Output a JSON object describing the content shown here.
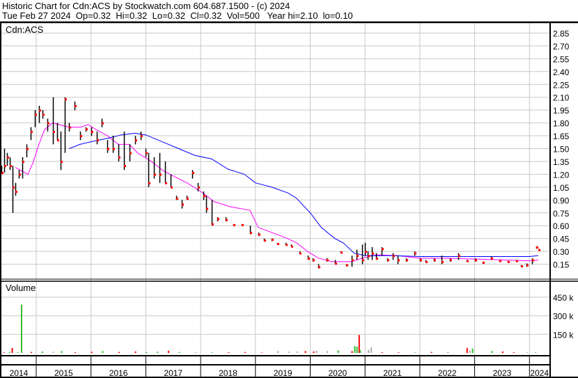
{
  "header": {
    "line1": "Historic Chart for Cdn:ACS by Stockwatch.com 604.687.1500 - (c) 2024",
    "line2": "Tue Feb 27 2024  Op=0.32  Hi=0.32  Lo=0.32  Cl=0.32  Vol=500   Year hi=2.10  lo=0.10"
  },
  "colors": {
    "hilo": "#000000",
    "close": "#ff0000",
    "ma_short": "#ff00ff",
    "ma_long": "#0000ff",
    "vol_up": "#33bb33",
    "vol_down": "#ff0000",
    "vol_flat": "#aaaaaa",
    "grid": "#c8c8c8"
  },
  "chart_data": {
    "type": "line",
    "price_panel": {
      "label": "Cdn:ACS",
      "y_ticks": [
        "2.85",
        "2.70",
        "2.55",
        "2.40",
        "2.25",
        "2.10",
        "1.95",
        "1.80",
        "1.65",
        "1.50",
        "1.35",
        "1.20",
        "1.05",
        "0.90",
        "0.75",
        "0.60",
        "0.45",
        "0.30",
        "0.15"
      ],
      "xlim": [
        2014.36,
        2024.37
      ],
      "ylim": [
        0,
        2.95
      ],
      "bars_t_hi_lo_close": [
        [
          2014.37,
          1.3,
          1.2,
          1.22
        ],
        [
          2014.42,
          1.5,
          1.22,
          1.3
        ],
        [
          2014.47,
          1.45,
          1.3,
          1.4
        ],
        [
          2014.52,
          1.4,
          1.25,
          1.3
        ],
        [
          2014.57,
          1.3,
          0.75,
          1.05
        ],
        [
          2014.62,
          1.1,
          0.95,
          1.0
        ],
        [
          2014.68,
          1.25,
          1.15,
          1.2
        ],
        [
          2014.75,
          1.4,
          1.15,
          1.35
        ],
        [
          2014.82,
          1.55,
          1.4,
          1.5
        ],
        [
          2014.9,
          1.75,
          1.6,
          1.7
        ],
        [
          2014.97,
          1.95,
          1.75,
          1.9
        ],
        [
          2015.05,
          2.0,
          1.8,
          1.95
        ],
        [
          2015.12,
          1.95,
          1.85,
          1.9
        ],
        [
          2015.2,
          1.85,
          1.7,
          1.8
        ],
        [
          2015.3,
          2.1,
          1.55,
          1.7
        ],
        [
          2015.38,
          1.8,
          1.6,
          1.6
        ],
        [
          2015.45,
          1.7,
          1.25,
          1.35
        ],
        [
          2015.52,
          2.1,
          1.45,
          2.08
        ],
        [
          2015.6,
          1.8,
          1.7,
          1.75
        ],
        [
          2015.7,
          2.05,
          1.95,
          2.0
        ],
        [
          2015.8,
          1.7,
          1.6,
          1.65
        ],
        [
          2015.9,
          1.75,
          1.7,
          1.73
        ],
        [
          2016.0,
          1.75,
          1.65,
          1.7
        ],
        [
          2016.1,
          1.7,
          1.55,
          1.6
        ],
        [
          2016.2,
          1.85,
          1.75,
          1.8
        ],
        [
          2016.3,
          1.6,
          1.45,
          1.5
        ],
        [
          2016.4,
          1.65,
          1.45,
          1.5
        ],
        [
          2016.5,
          1.55,
          1.35,
          1.4
        ],
        [
          2016.6,
          1.7,
          1.25,
          1.3
        ],
        [
          2016.7,
          1.55,
          1.35,
          1.45
        ],
        [
          2016.8,
          1.65,
          1.55,
          1.6
        ],
        [
          2016.9,
          1.7,
          1.6,
          1.65
        ],
        [
          2017.0,
          1.5,
          1.4,
          1.45
        ],
        [
          2017.05,
          1.45,
          1.05,
          1.1
        ],
        [
          2017.15,
          1.4,
          1.15,
          1.2
        ],
        [
          2017.25,
          1.45,
          1.1,
          1.2
        ],
        [
          2017.35,
          1.35,
          1.1,
          1.1
        ],
        [
          2017.45,
          1.2,
          1.05,
          1.05
        ],
        [
          2017.55,
          0.95,
          0.9,
          0.92
        ],
        [
          2017.65,
          0.9,
          0.8,
          0.85
        ],
        [
          2017.75,
          0.95,
          0.9,
          0.92
        ],
        [
          2017.85,
          1.25,
          1.15,
          1.22
        ],
        [
          2017.95,
          1.1,
          1.0,
          1.05
        ],
        [
          2018.05,
          1.0,
          0.9,
          0.95
        ],
        [
          2018.1,
          0.95,
          0.75,
          0.8
        ],
        [
          2018.2,
          0.9,
          0.6,
          0.62
        ],
        [
          2018.3,
          0.7,
          0.65,
          0.68
        ],
        [
          2018.45,
          0.7,
          0.65,
          0.67
        ],
        [
          2018.6,
          0.62,
          0.6,
          0.61
        ],
        [
          2018.75,
          0.62,
          0.6,
          0.61
        ],
        [
          2018.9,
          0.6,
          0.5,
          0.52
        ],
        [
          2019.05,
          0.52,
          0.48,
          0.5
        ],
        [
          2019.15,
          0.45,
          0.42,
          0.43
        ],
        [
          2019.3,
          0.45,
          0.42,
          0.44
        ],
        [
          2019.4,
          0.4,
          0.38,
          0.39
        ],
        [
          2019.55,
          0.4,
          0.38,
          0.38
        ],
        [
          2019.65,
          0.38,
          0.35,
          0.36
        ],
        [
          2019.8,
          0.3,
          0.27,
          0.28
        ],
        [
          2019.95,
          0.25,
          0.2,
          0.22
        ],
        [
          2020.05,
          0.22,
          0.18,
          0.2
        ],
        [
          2020.15,
          0.15,
          0.1,
          0.12
        ],
        [
          2020.3,
          0.22,
          0.18,
          0.2
        ],
        [
          2020.45,
          0.2,
          0.15,
          0.16
        ],
        [
          2020.55,
          0.3,
          0.28,
          0.29
        ],
        [
          2020.65,
          0.15,
          0.13,
          0.14
        ],
        [
          2020.75,
          0.25,
          0.12,
          0.2
        ],
        [
          2020.85,
          0.32,
          0.2,
          0.25
        ],
        [
          2020.95,
          0.38,
          0.15,
          0.2
        ],
        [
          2021.0,
          0.4,
          0.25,
          0.3
        ],
        [
          2021.05,
          0.3,
          0.2,
          0.25
        ],
        [
          2021.12,
          0.35,
          0.2,
          0.28
        ],
        [
          2021.2,
          0.28,
          0.2,
          0.22
        ],
        [
          2021.3,
          0.35,
          0.25,
          0.33
        ],
        [
          2021.4,
          0.22,
          0.18,
          0.2
        ],
        [
          2021.5,
          0.28,
          0.2,
          0.25
        ],
        [
          2021.6,
          0.25,
          0.15,
          0.2
        ],
        [
          2021.75,
          0.22,
          0.18,
          0.2
        ],
        [
          2021.9,
          0.3,
          0.25,
          0.28
        ],
        [
          2022.0,
          0.22,
          0.18,
          0.2
        ],
        [
          2022.1,
          0.2,
          0.17,
          0.18
        ],
        [
          2022.25,
          0.22,
          0.18,
          0.2
        ],
        [
          2022.4,
          0.25,
          0.15,
          0.18
        ],
        [
          2022.55,
          0.22,
          0.18,
          0.2
        ],
        [
          2022.7,
          0.28,
          0.2,
          0.25
        ],
        [
          2022.85,
          0.2,
          0.18,
          0.19
        ],
        [
          2023.0,
          0.22,
          0.18,
          0.2
        ],
        [
          2023.15,
          0.18,
          0.16,
          0.17
        ],
        [
          2023.3,
          0.24,
          0.2,
          0.22
        ],
        [
          2023.45,
          0.2,
          0.18,
          0.19
        ],
        [
          2023.6,
          0.19,
          0.17,
          0.18
        ],
        [
          2023.75,
          0.2,
          0.18,
          0.19
        ],
        [
          2023.85,
          0.14,
          0.12,
          0.13
        ],
        [
          2023.95,
          0.16,
          0.12,
          0.14
        ],
        [
          2024.05,
          0.22,
          0.15,
          0.2
        ],
        [
          2024.12,
          0.36,
          0.33,
          0.35
        ],
        [
          2024.16,
          0.32,
          0.32,
          0.32
        ]
      ],
      "ma_short": [
        [
          2014.62,
          1.28
        ],
        [
          2014.85,
          1.2
        ],
        [
          2014.95,
          1.35
        ],
        [
          2015.05,
          1.55
        ],
        [
          2015.15,
          1.72
        ],
        [
          2015.3,
          1.8
        ],
        [
          2015.6,
          1.75
        ],
        [
          2015.8,
          1.75
        ],
        [
          2015.95,
          1.78
        ],
        [
          2016.1,
          1.72
        ],
        [
          2016.3,
          1.65
        ],
        [
          2016.5,
          1.55
        ],
        [
          2016.7,
          1.55
        ],
        [
          2016.85,
          1.45
        ],
        [
          2017.1,
          1.35
        ],
        [
          2017.3,
          1.25
        ],
        [
          2017.5,
          1.18
        ],
        [
          2017.75,
          1.1
        ],
        [
          2018.0,
          1.0
        ],
        [
          2018.25,
          0.88
        ],
        [
          2018.55,
          0.82
        ],
        [
          2018.9,
          0.78
        ],
        [
          2019.05,
          0.58
        ],
        [
          2019.3,
          0.52
        ],
        [
          2019.55,
          0.46
        ],
        [
          2019.75,
          0.4
        ],
        [
          2019.95,
          0.3
        ],
        [
          2020.15,
          0.22
        ],
        [
          2020.4,
          0.18
        ],
        [
          2020.75,
          0.18
        ],
        [
          2020.95,
          0.22
        ],
        [
          2021.2,
          0.26
        ],
        [
          2021.6,
          0.25
        ],
        [
          2022.0,
          0.22
        ],
        [
          2022.5,
          0.22
        ],
        [
          2023.0,
          0.21
        ],
        [
          2023.5,
          0.2
        ],
        [
          2024.0,
          0.19
        ],
        [
          2024.16,
          0.2
        ]
      ],
      "ma_long": [
        [
          2015.6,
          1.5
        ],
        [
          2015.8,
          1.55
        ],
        [
          2016.0,
          1.58
        ],
        [
          2016.3,
          1.62
        ],
        [
          2016.55,
          1.66
        ],
        [
          2016.8,
          1.68
        ],
        [
          2017.0,
          1.66
        ],
        [
          2017.3,
          1.58
        ],
        [
          2017.6,
          1.5
        ],
        [
          2017.9,
          1.42
        ],
        [
          2018.2,
          1.38
        ],
        [
          2018.5,
          1.26
        ],
        [
          2018.8,
          1.2
        ],
        [
          2019.0,
          1.1
        ],
        [
          2019.3,
          1.05
        ],
        [
          2019.6,
          0.98
        ],
        [
          2019.75,
          0.92
        ],
        [
          2020.0,
          0.75
        ],
        [
          2020.2,
          0.58
        ],
        [
          2020.45,
          0.45
        ],
        [
          2020.6,
          0.4
        ],
        [
          2020.8,
          0.28
        ],
        [
          2021.0,
          0.25
        ],
        [
          2021.5,
          0.25
        ],
        [
          2022.0,
          0.24
        ],
        [
          2023.0,
          0.24
        ],
        [
          2024.0,
          0.24
        ],
        [
          2024.16,
          0.25
        ]
      ]
    },
    "volume_panel": {
      "label": "Volume",
      "y_ticks": [
        "450 k",
        "300 k",
        "150 k"
      ],
      "ylim": [
        0,
        600
      ],
      "bars_t_k_dir": [
        [
          2014.4,
          5,
          "down"
        ],
        [
          2014.5,
          8,
          "up"
        ],
        [
          2014.55,
          40,
          "down"
        ],
        [
          2014.65,
          6,
          "up"
        ],
        [
          2014.72,
          390,
          "up"
        ],
        [
          2014.9,
          8,
          "down"
        ],
        [
          2015.1,
          12,
          "up"
        ],
        [
          2015.3,
          10,
          "flat"
        ],
        [
          2015.45,
          15,
          "up"
        ],
        [
          2015.7,
          6,
          "down"
        ],
        [
          2016.0,
          10,
          "down"
        ],
        [
          2016.2,
          15,
          "up"
        ],
        [
          2016.5,
          8,
          "down"
        ],
        [
          2016.8,
          12,
          "down"
        ],
        [
          2017.0,
          8,
          "up"
        ],
        [
          2017.2,
          10,
          "up"
        ],
        [
          2017.4,
          18,
          "down"
        ],
        [
          2017.6,
          8,
          "up"
        ],
        [
          2017.9,
          6,
          "flat"
        ],
        [
          2018.2,
          5,
          "up"
        ],
        [
          2018.5,
          6,
          "down"
        ],
        [
          2018.8,
          8,
          "down"
        ],
        [
          2019.1,
          4,
          "down"
        ],
        [
          2019.4,
          15,
          "flat"
        ],
        [
          2019.6,
          10,
          "flat"
        ],
        [
          2019.75,
          12,
          "flat"
        ],
        [
          2019.9,
          15,
          "down"
        ],
        [
          2020.05,
          12,
          "down"
        ],
        [
          2020.1,
          18,
          "flat"
        ],
        [
          2020.3,
          15,
          "flat"
        ],
        [
          2020.5,
          20,
          "up"
        ],
        [
          2020.75,
          15,
          "down"
        ],
        [
          2020.8,
          55,
          "up"
        ],
        [
          2020.84,
          50,
          "up"
        ],
        [
          2020.88,
          145,
          "down"
        ],
        [
          2020.9,
          22,
          "up"
        ],
        [
          2021.05,
          25,
          "flat"
        ],
        [
          2021.1,
          45,
          "flat"
        ],
        [
          2021.3,
          6,
          "down"
        ],
        [
          2021.6,
          5,
          "down"
        ],
        [
          2021.9,
          4,
          "up"
        ],
        [
          2022.2,
          8,
          "down"
        ],
        [
          2022.5,
          6,
          "up"
        ],
        [
          2022.85,
          40,
          "down"
        ],
        [
          2022.9,
          18,
          "flat"
        ],
        [
          2022.95,
          35,
          "up"
        ],
        [
          2023.3,
          15,
          "up"
        ],
        [
          2023.5,
          12,
          "down"
        ],
        [
          2023.7,
          6,
          "down"
        ],
        [
          2023.95,
          4,
          "up"
        ],
        [
          2024.1,
          5,
          "up"
        ]
      ]
    },
    "x_ticks": [
      "2014",
      "2015",
      "2016",
      "2017",
      "2018",
      "2019",
      "2020",
      "2021",
      "2022",
      "2023",
      "2024"
    ]
  }
}
